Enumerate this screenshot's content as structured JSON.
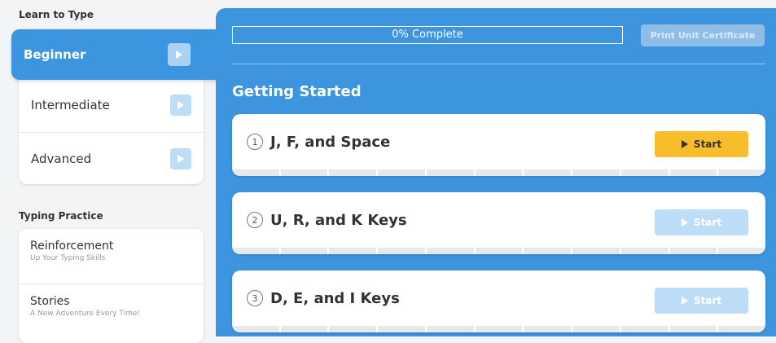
{
  "sidebar": {
    "learn_title": "Learn to Type",
    "levels": [
      {
        "label": "Beginner"
      },
      {
        "label": "Intermediate"
      },
      {
        "label": "Advanced"
      }
    ],
    "practice_title": "Typing Practice",
    "practice": [
      {
        "title": "Reinforcement",
        "subtitle": "Up Your Typing Skills"
      },
      {
        "title": "Stories",
        "subtitle": "A New Adventure Every Time!"
      }
    ]
  },
  "main": {
    "progress_label": "0% Complete",
    "progress_value": 0,
    "print_label": "Print Unit Certificate",
    "section_title": "Getting Started",
    "lessons": [
      {
        "number": "1",
        "title": "J, F, and Space",
        "start_label": "Start"
      },
      {
        "number": "2",
        "title": "U, R, and K Keys",
        "start_label": "Start"
      },
      {
        "number": "3",
        "title": "D, E, and I Keys",
        "start_label": "Start"
      }
    ]
  },
  "colors": {
    "accent": "#3d95df",
    "start_active": "#f7bd2b",
    "start_disabled": "#bddcf5"
  }
}
